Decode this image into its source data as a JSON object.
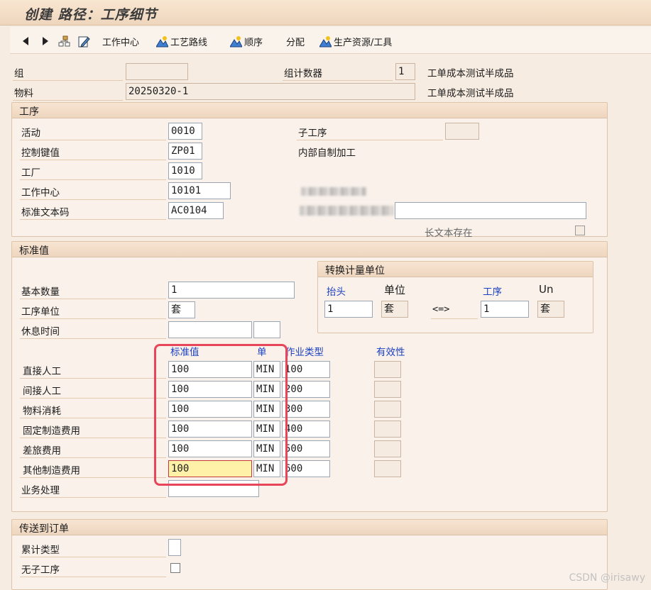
{
  "window": {
    "title": "创建 路径：工序细节"
  },
  "toolbar": {
    "work_center": "工作中心",
    "routing": "工艺路线",
    "sequence": "顺序",
    "assignment": "分配",
    "prt": "生产资源/工具"
  },
  "header": {
    "group_label": "组",
    "group_value": "",
    "group_counter_label": "组计数器",
    "group_counter_value": "1",
    "desc1": "工单成本测试半成品",
    "material_label": "物料",
    "material_value": "20250320-1",
    "desc2": "工单成本测试半成品"
  },
  "operation": {
    "section_title": "工序",
    "activity_label": "活动",
    "activity_value": "0010",
    "sub_op_label": "子工序",
    "sub_op_value": "",
    "control_key_label": "控制键值",
    "control_key_value": "ZP01",
    "control_key_desc": "内部自制加工",
    "plant_label": "工厂",
    "plant_value": "1010",
    "work_center_label": "工作中心",
    "work_center_value": "10101",
    "std_text_label": "标准文本码",
    "std_text_value": "AC0104",
    "std_text_desc": "",
    "long_text_label": "长文本存在"
  },
  "std_values": {
    "section_title": "标准值",
    "conversion": {
      "title": "转换计量单位",
      "header_label": "抬头",
      "unit_label": "单位",
      "op_label": "工序",
      "un_label": "Un",
      "header_value": "1",
      "header_unit": "套",
      "arrow": "<=>",
      "op_value": "1",
      "op_unit": "套"
    },
    "base_qty_label": "基本数量",
    "base_qty_value": "1",
    "op_unit_label": "工序单位",
    "op_unit_value": "套",
    "break_time_label": "休息时间",
    "col_std_value": "标准值",
    "col_unit": "单",
    "col_activity_type": "作业类型",
    "col_validity": "有效性",
    "rows": [
      {
        "label": "直接人工",
        "value": "100",
        "unit": "MIN",
        "activity": "100"
      },
      {
        "label": "间接人工",
        "value": "100",
        "unit": "MIN",
        "activity": "200"
      },
      {
        "label": "物料消耗",
        "value": "100",
        "unit": "MIN",
        "activity": "300"
      },
      {
        "label": "固定制造费用",
        "value": "100",
        "unit": "MIN",
        "activity": "400"
      },
      {
        "label": "差旅费用",
        "value": "100",
        "unit": "MIN",
        "activity": "500"
      },
      {
        "label": "其他制造费用",
        "value": "100",
        "unit": "MIN",
        "activity": "600"
      }
    ],
    "business_process_label": "业务处理"
  },
  "order_transfer": {
    "section_title": "传送到订单",
    "cum_type_label": "累计类型",
    "no_sub_op_label": "无子工序"
  },
  "watermark": "CSDN @irisawy",
  "colors": {
    "accent_blue": "#1a3fbf",
    "highlight_yellow": "#fff2a8",
    "callout_red": "#e8455a"
  }
}
